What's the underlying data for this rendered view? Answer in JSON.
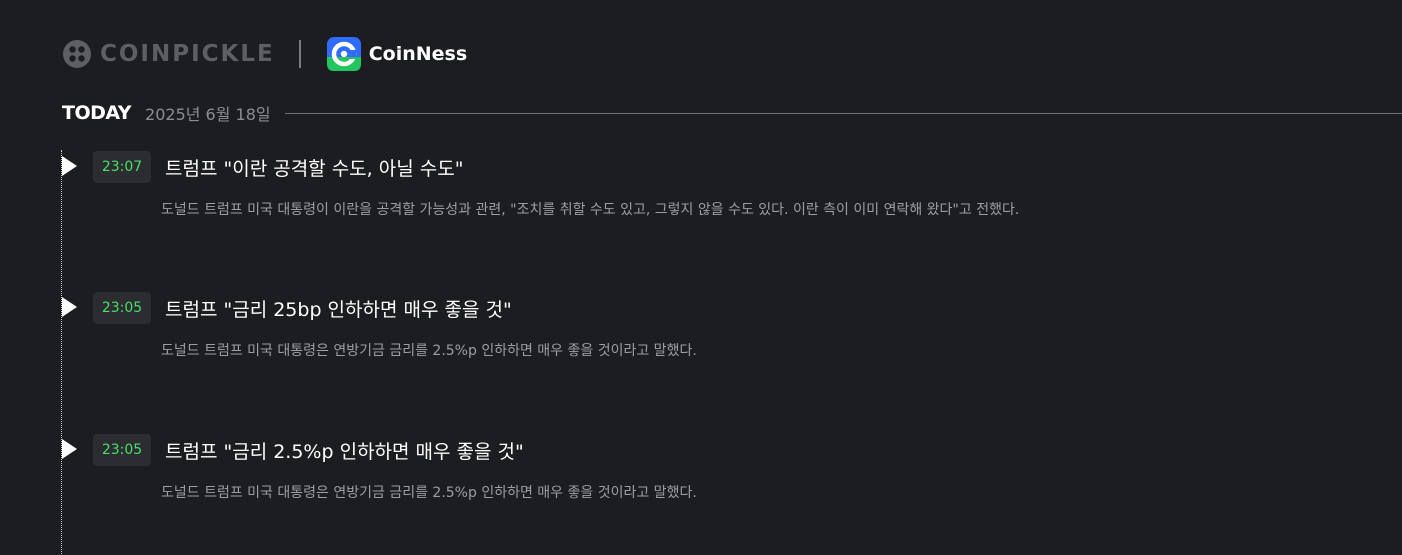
{
  "header": {
    "coinpickle_logo_text": "COINPICKLE",
    "coinness_logo_text": "CoinNess"
  },
  "today": {
    "label": "TODAY",
    "date": "2025년 6월 18일"
  },
  "news": [
    {
      "time": "23:07",
      "title": "트럼프 \"이란 공격할 수도, 아닐 수도\"",
      "summary": "도널드 트럼프 미국 대통령이 이란을 공격할 가능성과 관련, \"조치를 취할 수도 있고, 그렇지 않을 수도 있다. 이란 측이 이미 연락해 왔다\"고 전했다."
    },
    {
      "time": "23:05",
      "title": "트럼프 \"금리 25bp 인하하면 매우 좋을 것\"",
      "summary": "도널드 트럼프 미국 대통령은 연방기금 금리를 2.5%p 인하하면 매우 좋을 것이라고 말했다."
    },
    {
      "time": "23:05",
      "title": "트럼프 \"금리 2.5%p 인하하면 매우 좋을 것\"",
      "summary": "도널드 트럼프 미국 대통령은 연방기금 금리를 2.5%p 인하하면 매우 좋을 것이라고 말했다."
    }
  ],
  "colors": {
    "background": "#1c1d21",
    "time_text": "#4ade6a",
    "coinness_brand": "#2f6bff"
  },
  "icons": {
    "coinpickle": "coinpickle-logo-icon",
    "coinness": "coinness-logo-icon",
    "timeline_marker": "play-arrow-icon"
  }
}
